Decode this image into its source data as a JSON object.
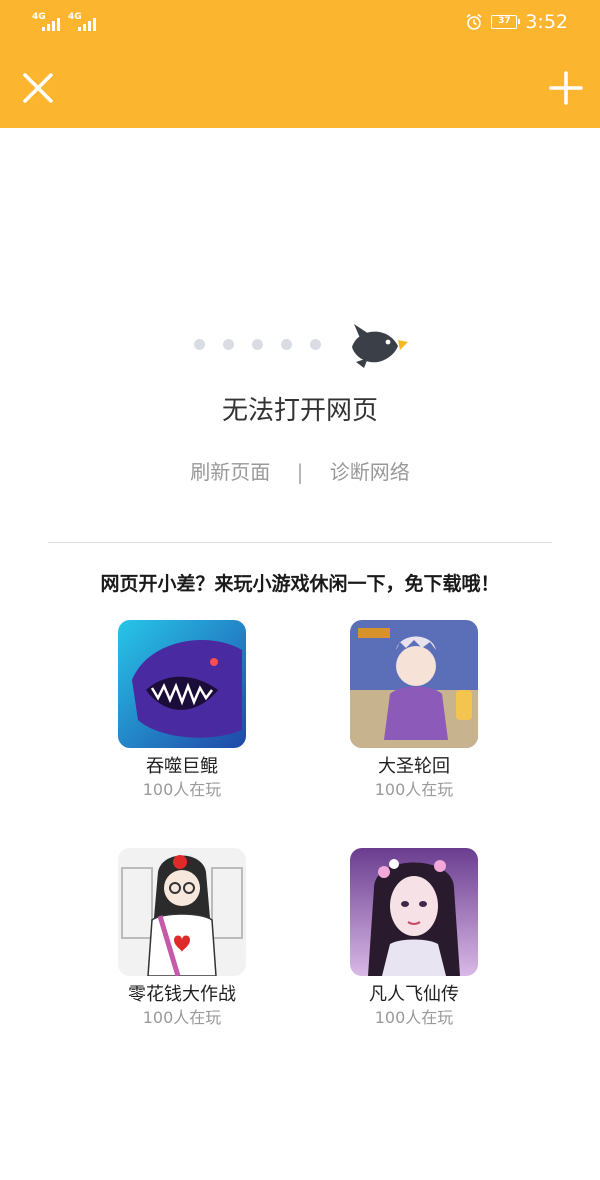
{
  "status_bar": {
    "network_1": "4G",
    "network_2": "4G",
    "battery": "37",
    "time": "3:52"
  },
  "toolbar": {
    "close_icon": "close-icon",
    "add_icon": "plus-icon",
    "background": "#fbb52f"
  },
  "error": {
    "title": "无法打开网页",
    "refresh": "刷新页面",
    "separator": "|",
    "diagnose": "诊断网络"
  },
  "promo": {
    "text": "网页开小差？来玩小游戏休闲一下，免下载哦！"
  },
  "games": [
    {
      "name": "吞噬巨鲲",
      "players": "100人在玩"
    },
    {
      "name": "大圣轮回",
      "players": "100人在玩"
    },
    {
      "name": "零花钱大作战",
      "players": "100人在玩"
    },
    {
      "name": "凡人飞仙传",
      "players": "100人在玩"
    }
  ]
}
